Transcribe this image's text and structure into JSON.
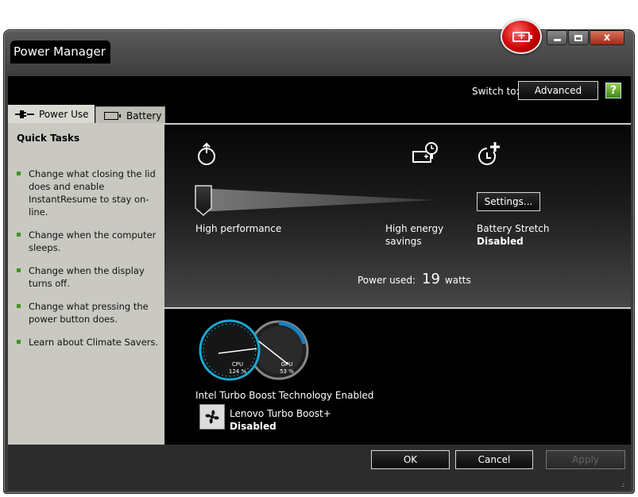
{
  "window": {
    "title": "Power Manager",
    "controls": [
      "minimize",
      "maximize",
      "close"
    ],
    "close_label": "x"
  },
  "topbar": {
    "switch_label": "Switch to:",
    "advanced_label": "Advanced",
    "help_label": "?"
  },
  "tabs": [
    {
      "label": "Power Use",
      "icon": "plug-icon",
      "selected": true
    },
    {
      "label": "Battery",
      "icon": "battery-icon",
      "selected": false
    }
  ],
  "sidebar": {
    "title": "Quick Tasks",
    "items": [
      "Change what closing the lid does and enable InstantResume to stay on-line.",
      "Change when the computer sleeps.",
      "Change when the display turns off.",
      "Change what pressing the power button does.",
      "Learn about Climate Savers."
    ]
  },
  "power_plan": {
    "left_label": "High performance",
    "right_label_line1": "High energy",
    "right_label_line2": "savings",
    "slider_value": 0
  },
  "battery_stretch": {
    "settings_label": "Settings...",
    "label": "Battery Stretch",
    "status": "Disabled"
  },
  "power_used": {
    "label": "Power used:",
    "value": "19",
    "unit": "watts"
  },
  "gauges": {
    "cpu_label": "CPU",
    "cpu_value": "124 %",
    "gpu_label": "GPU",
    "gpu_value": "53 %"
  },
  "turbo": {
    "status_line": "Intel Turbo Boost Technology Enabled",
    "plus_label": "Lenovo Turbo Boost+",
    "plus_status": "Disabled"
  },
  "footer": {
    "ok_label": "OK",
    "cancel_label": "Cancel",
    "apply_label": "Apply"
  },
  "colors": {
    "accent_green": "#3c9a1a",
    "logo_red": "#cc0000",
    "gauge_cyan": "#1aa8d0"
  }
}
